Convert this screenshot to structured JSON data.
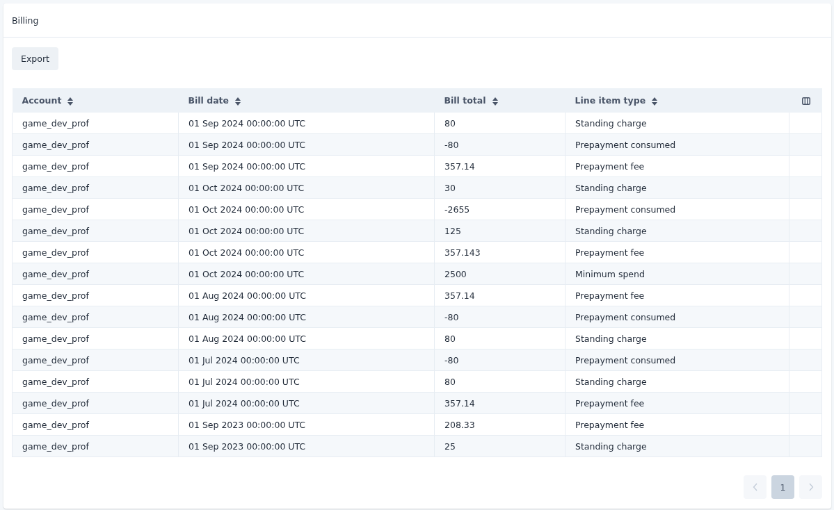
{
  "title": "Billing",
  "toolbar": {
    "export_button": "Export"
  },
  "table": {
    "columns": [
      {
        "label": "Account",
        "sortable": true
      },
      {
        "label": "Bill date",
        "sortable": true
      },
      {
        "label": "Bill total",
        "sortable": true
      },
      {
        "label": "Line item type",
        "sortable": true
      }
    ],
    "rows": [
      [
        "game_dev_prof",
        "01 Sep 2024 00:00:00 UTC",
        "80",
        "Standing charge"
      ],
      [
        "game_dev_prof",
        "01 Sep 2024 00:00:00 UTC",
        "-80",
        "Prepayment consumed"
      ],
      [
        "game_dev_prof",
        "01 Sep 2024 00:00:00 UTC",
        "357.14",
        "Prepayment fee"
      ],
      [
        "game_dev_prof",
        "01 Oct 2024 00:00:00 UTC",
        "30",
        "Standing charge"
      ],
      [
        "game_dev_prof",
        "01 Oct 2024 00:00:00 UTC",
        "-2655",
        "Prepayment consumed"
      ],
      [
        "game_dev_prof",
        "01 Oct 2024 00:00:00 UTC",
        "125",
        "Standing charge"
      ],
      [
        "game_dev_prof",
        "01 Oct 2024 00:00:00 UTC",
        "357.143",
        "Prepayment fee"
      ],
      [
        "game_dev_prof",
        "01 Oct 2024 00:00:00 UTC",
        "2500",
        "Minimum spend"
      ],
      [
        "game_dev_prof",
        "01 Aug 2024 00:00:00 UTC",
        "357.14",
        "Prepayment fee"
      ],
      [
        "game_dev_prof",
        "01 Aug 2024 00:00:00 UTC",
        "-80",
        "Prepayment consumed"
      ],
      [
        "game_dev_prof",
        "01 Aug 2024 00:00:00 UTC",
        "80",
        "Standing charge"
      ],
      [
        "game_dev_prof",
        "01 Jul 2024 00:00:00 UTC",
        "-80",
        "Prepayment consumed"
      ],
      [
        "game_dev_prof",
        "01 Jul 2024 00:00:00 UTC",
        "80",
        "Standing charge"
      ],
      [
        "game_dev_prof",
        "01 Jul 2024 00:00:00 UTC",
        "357.14",
        "Prepayment fee"
      ],
      [
        "game_dev_prof",
        "01 Sep 2023 00:00:00 UTC",
        "208.33",
        "Prepayment fee"
      ],
      [
        "game_dev_prof",
        "01 Sep 2023 00:00:00 UTC",
        "25",
        "Standing charge"
      ]
    ]
  },
  "pagination": {
    "prev_disabled": true,
    "next_disabled": true,
    "pages": [
      {
        "label": "1",
        "selected": true
      }
    ]
  }
}
